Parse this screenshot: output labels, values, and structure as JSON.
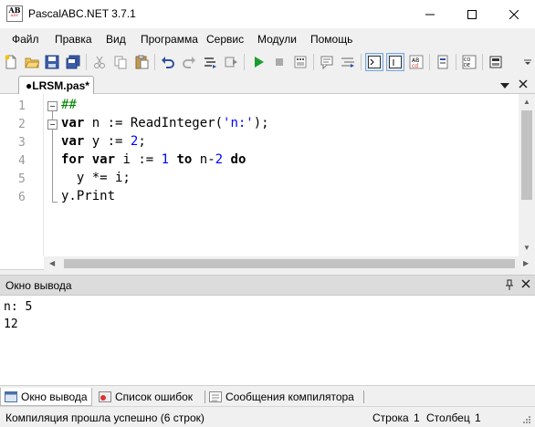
{
  "window": {
    "title": "PascalABC.NET 3.7.1",
    "icon": "pascalabc-app-icon"
  },
  "menu": [
    {
      "id": "file",
      "label": "Файл"
    },
    {
      "id": "edit",
      "label": "Правка"
    },
    {
      "id": "view",
      "label": "Вид"
    },
    {
      "id": "program",
      "label": "Программа"
    },
    {
      "id": "service",
      "label": "Сервис"
    },
    {
      "id": "modules",
      "label": "Модули"
    },
    {
      "id": "help",
      "label": "Помощь"
    }
  ],
  "toolbar": {
    "icons": [
      "new-file-icon",
      "open-folder-icon",
      "save-icon",
      "save-all-icon",
      "cut-icon",
      "copy-icon",
      "paste-icon",
      "undo-icon",
      "redo-icon",
      "format-icon",
      "step-icon",
      "run-icon",
      "stop-icon",
      "debug-icon",
      "comment-icon",
      "uncomment-icon",
      "output-console-icon",
      "text-mode-icon",
      "ab-icon",
      "compile-icon",
      "code-icon",
      "database-icon"
    ]
  },
  "editor": {
    "tab_label": "●LRSM.pas*",
    "line_numbers": [
      "1",
      "2",
      "3",
      "4",
      "5",
      "6"
    ],
    "lines": [
      [
        {
          "t": "##",
          "c": "cmt"
        }
      ],
      [
        {
          "t": "var",
          "c": "kw"
        },
        {
          "t": " n := ReadInteger(",
          "c": ""
        },
        {
          "t": "'n:'",
          "c": "str"
        },
        {
          "t": ");",
          "c": ""
        }
      ],
      [
        {
          "t": "var",
          "c": "kw"
        },
        {
          "t": " y := ",
          "c": ""
        },
        {
          "t": "2",
          "c": "num"
        },
        {
          "t": ";",
          "c": ""
        }
      ],
      [
        {
          "t": "for",
          "c": "kw"
        },
        {
          "t": " ",
          "c": ""
        },
        {
          "t": "var",
          "c": "kw"
        },
        {
          "t": " i := ",
          "c": ""
        },
        {
          "t": "1",
          "c": "num"
        },
        {
          "t": " ",
          "c": ""
        },
        {
          "t": "to",
          "c": "kw"
        },
        {
          "t": " n-",
          "c": ""
        },
        {
          "t": "2",
          "c": "num"
        },
        {
          "t": " ",
          "c": ""
        },
        {
          "t": "do",
          "c": "kw"
        }
      ],
      [
        {
          "t": "  y *= i;",
          "c": ""
        }
      ],
      [
        {
          "t": "y.Print",
          "c": ""
        }
      ]
    ]
  },
  "output_panel": {
    "title": "Окно вывода",
    "lines": [
      "n: 5",
      "12"
    ]
  },
  "bottom_tabs": [
    {
      "label": "Окно вывода",
      "icon": "output-window-icon",
      "active": true
    },
    {
      "label": "Список ошибок",
      "icon": "error-list-icon",
      "active": false
    },
    {
      "label": "Сообщения компилятора",
      "icon": "compiler-messages-icon",
      "active": false
    }
  ],
  "status": {
    "message": "Компиляция прошла успешно (6 строк)",
    "line_label": "Строка",
    "line_value": "1",
    "col_label": "Столбец",
    "col_value": "1"
  }
}
